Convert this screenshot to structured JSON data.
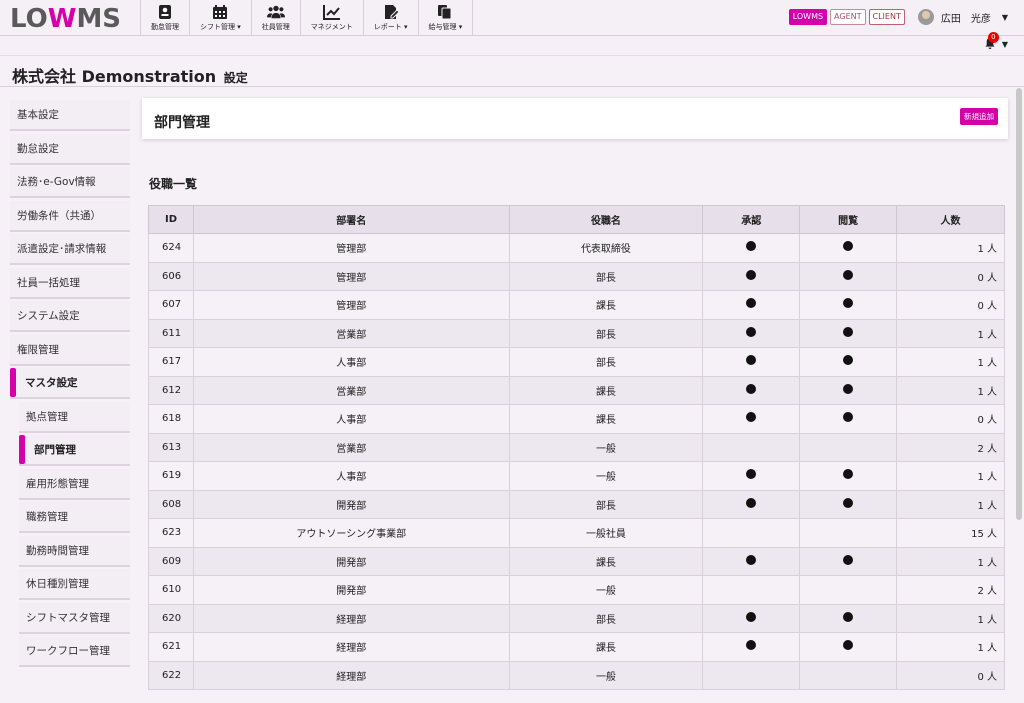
{
  "brand": {
    "prefix": "LO",
    "mark": "W",
    "suffix": "MS",
    "accent": "#d400aa"
  },
  "nav": [
    {
      "label": "勤怠管理",
      "icon": "id-card-icon",
      "dropdown": false
    },
    {
      "label": "シフト管理",
      "icon": "calendar-icon",
      "dropdown": true
    },
    {
      "label": "社員管理",
      "icon": "users-icon",
      "dropdown": false
    },
    {
      "label": "マネジメント",
      "icon": "line-chart-icon",
      "dropdown": false
    },
    {
      "label": "レポート",
      "icon": "report-edit-icon",
      "dropdown": true
    },
    {
      "label": "給与管理",
      "icon": "copy-documents-icon",
      "dropdown": true
    }
  ],
  "topright": {
    "badge_lowms": "LOWMS",
    "badge_agent": "AGENT",
    "badge_client": "CLIENT",
    "user_name": "広田　光彦",
    "notification_count": "0"
  },
  "page": {
    "company": "株式会社 Demonstration",
    "section": "設定"
  },
  "sidebar": [
    {
      "label": "基本設定",
      "sub": false,
      "active": false
    },
    {
      "label": "勤怠設定",
      "sub": false,
      "active": false
    },
    {
      "label": "法務･e-Gov情報",
      "sub": false,
      "active": false
    },
    {
      "label": "労働条件（共通）",
      "sub": false,
      "active": false
    },
    {
      "label": "派遣設定･請求情報",
      "sub": false,
      "active": false
    },
    {
      "label": "社員一括処理",
      "sub": false,
      "active": false
    },
    {
      "label": "システム設定",
      "sub": false,
      "active": false
    },
    {
      "label": "権限管理",
      "sub": false,
      "active": false
    },
    {
      "label": "マスタ設定",
      "sub": false,
      "active": true
    },
    {
      "label": "拠点管理",
      "sub": true,
      "active": false
    },
    {
      "label": "部門管理",
      "sub": true,
      "active": true
    },
    {
      "label": "雇用形態管理",
      "sub": true,
      "active": false
    },
    {
      "label": "職務管理",
      "sub": true,
      "active": false
    },
    {
      "label": "勤務時間管理",
      "sub": true,
      "active": false
    },
    {
      "label": "休日種別管理",
      "sub": true,
      "active": false
    },
    {
      "label": "シフトマスタ管理",
      "sub": true,
      "active": false
    },
    {
      "label": "ワークフロー管理",
      "sub": true,
      "active": false
    }
  ],
  "panel": {
    "title": "部門管理",
    "new_button": "新規追加"
  },
  "list": {
    "title": "役職一覧",
    "columns": [
      "ID",
      "部署名",
      "役職名",
      "承認",
      "閲覧",
      "人数"
    ],
    "rows": [
      {
        "id": "624",
        "dept": "管理部",
        "role": "代表取締役",
        "approve": true,
        "view": true,
        "count": "1 人"
      },
      {
        "id": "606",
        "dept": "管理部",
        "role": "部長",
        "approve": true,
        "view": true,
        "count": "0 人"
      },
      {
        "id": "607",
        "dept": "管理部",
        "role": "課長",
        "approve": true,
        "view": true,
        "count": "0 人"
      },
      {
        "id": "611",
        "dept": "営業部",
        "role": "部長",
        "approve": true,
        "view": true,
        "count": "1 人"
      },
      {
        "id": "617",
        "dept": "人事部",
        "role": "部長",
        "approve": true,
        "view": true,
        "count": "1 人"
      },
      {
        "id": "612",
        "dept": "営業部",
        "role": "課長",
        "approve": true,
        "view": true,
        "count": "1 人"
      },
      {
        "id": "618",
        "dept": "人事部",
        "role": "課長",
        "approve": true,
        "view": true,
        "count": "0 人"
      },
      {
        "id": "613",
        "dept": "営業部",
        "role": "一般",
        "approve": false,
        "view": false,
        "count": "2 人"
      },
      {
        "id": "619",
        "dept": "人事部",
        "role": "一般",
        "approve": true,
        "view": true,
        "count": "1 人"
      },
      {
        "id": "608",
        "dept": "開発部",
        "role": "部長",
        "approve": true,
        "view": true,
        "count": "1 人"
      },
      {
        "id": "623",
        "dept": "アウトソーシング事業部",
        "role": "一般社員",
        "approve": false,
        "view": false,
        "count": "15 人"
      },
      {
        "id": "609",
        "dept": "開発部",
        "role": "課長",
        "approve": true,
        "view": true,
        "count": "1 人"
      },
      {
        "id": "610",
        "dept": "開発部",
        "role": "一般",
        "approve": false,
        "view": false,
        "count": "2 人"
      },
      {
        "id": "620",
        "dept": "経理部",
        "role": "部長",
        "approve": true,
        "view": true,
        "count": "1 人"
      },
      {
        "id": "621",
        "dept": "経理部",
        "role": "課長",
        "approve": true,
        "view": true,
        "count": "1 人"
      },
      {
        "id": "622",
        "dept": "経理部",
        "role": "一般",
        "approve": false,
        "view": false,
        "count": "0 人"
      }
    ]
  }
}
